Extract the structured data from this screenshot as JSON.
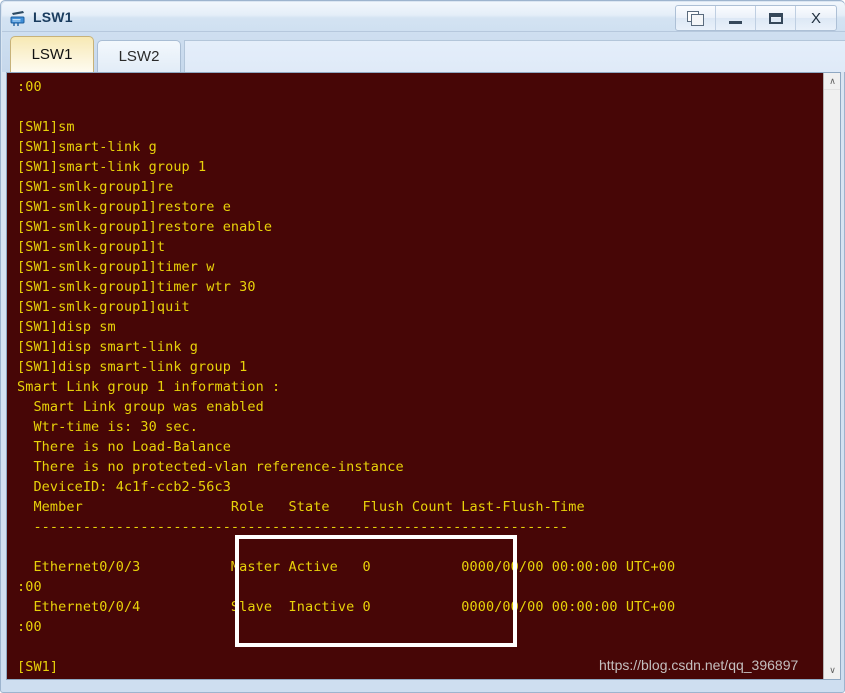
{
  "window": {
    "title": "LSW1",
    "icon": "switch-device-icon",
    "controls": [
      {
        "name": "restore-window-button",
        "icon": "restore-icon",
        "label": ""
      },
      {
        "name": "minimize-window-button",
        "icon": "minimize-icon",
        "label": ""
      },
      {
        "name": "maximize-window-button",
        "icon": "maximize-icon",
        "label": ""
      },
      {
        "name": "close-window-button",
        "icon": "close-icon",
        "label": "X"
      }
    ]
  },
  "tabs": [
    {
      "label": "LSW1",
      "active": true
    },
    {
      "label": "LSW2",
      "active": false
    }
  ],
  "terminal": {
    "background_color": "#470606",
    "text_color": "#e8d20a",
    "lines": [
      ":00",
      "",
      "[SW1]sm",
      "[SW1]smart-link g",
      "[SW1]smart-link group 1",
      "[SW1-smlk-group1]re",
      "[SW1-smlk-group1]restore e",
      "[SW1-smlk-group1]restore enable",
      "[SW1-smlk-group1]t",
      "[SW1-smlk-group1]timer w",
      "[SW1-smlk-group1]timer wtr 30",
      "[SW1-smlk-group1]quit",
      "[SW1]disp sm",
      "[SW1]disp smart-link g",
      "[SW1]disp smart-link group 1",
      "Smart Link group 1 information :",
      "  Smart Link group was enabled",
      "  Wtr-time is: 30 sec.",
      "  There is no Load-Balance",
      "  There is no protected-vlan reference-instance",
      "  DeviceID: 4c1f-ccb2-56c3",
      "  Member                  Role   State    Flush Count Last-Flush-Time",
      "  -----------------------------------------------------------------",
      "",
      "  Ethernet0/0/3           Master Active   0           0000/00/00 00:00:00 UTC+00",
      ":00",
      "  Ethernet0/0/4           Slave  Inactive 0           0000/00/00 00:00:00 UTC+00",
      ":00",
      "",
      "[SW1]"
    ],
    "smart_link_table": {
      "type": "table",
      "columns": [
        "Member",
        "Role",
        "State",
        "Flush Count",
        "Last-Flush-Time"
      ],
      "rows": [
        [
          "Ethernet0/0/3",
          "Master",
          "Active",
          "0",
          "0000/00/00 00:00:00 UTC+00:00"
        ],
        [
          "Ethernet0/0/4",
          "Slave",
          "Inactive",
          "0",
          "0000/00/00 00:00:00 UTC+00:00"
        ]
      ]
    },
    "group_info": {
      "header": "Smart Link group 1 information :",
      "enabled": "Smart Link group was enabled",
      "wtr_time": "Wtr-time is: 30 sec.",
      "load_balance": "There is no Load-Balance",
      "protected_vlan": "There is no protected-vlan reference-instance",
      "device_id": "DeviceID: 4c1f-ccb2-56c3"
    }
  },
  "annotation": {
    "highlight_box_color": "#ffffff"
  },
  "watermark": {
    "text": "https://blog.csdn.net/qq_396897"
  },
  "scrollbar": {
    "up_arrow": "∧",
    "down_arrow": "∨"
  }
}
